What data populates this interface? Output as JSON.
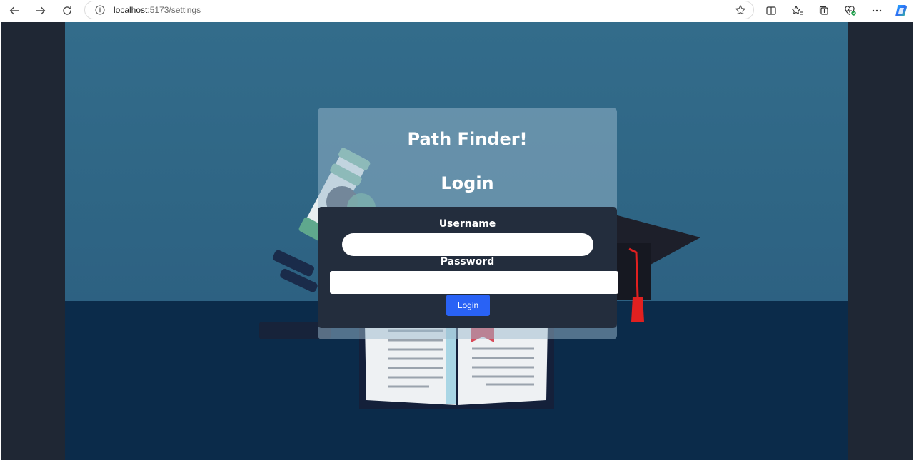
{
  "browser": {
    "url_host": "localhost",
    "url_path": ":5173/settings"
  },
  "icons": {
    "back": "back-arrow-icon",
    "forward": "forward-arrow-icon",
    "refresh": "refresh-icon",
    "site_info": "info-icon",
    "favorite": "star-icon",
    "split_screen": "split-screen-icon",
    "favorites": "favorites-icon",
    "collections": "collections-icon",
    "browser_essentials": "heart-pulse-icon",
    "more": "more-icon",
    "copilot": "copilot-icon"
  },
  "page": {
    "title": "Path Finder!",
    "subtitle": "Login",
    "username_label": "Username",
    "username_value": "",
    "password_label": "Password",
    "password_value": "",
    "login_button": "Login"
  },
  "colors": {
    "accent": "#2962f5",
    "panel": "#232d3d",
    "page_background": "#1f2734"
  }
}
